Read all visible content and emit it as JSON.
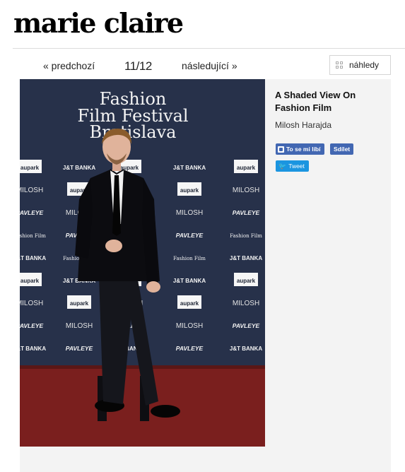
{
  "header": {
    "logo": "marie claire"
  },
  "pager": {
    "prev": "« predchozí",
    "count": "11/12",
    "next": "následující »"
  },
  "thumbs_button": {
    "label": "náhledy",
    "icon": "grid-icon"
  },
  "photo": {
    "backdrop_title": [
      "Fashion",
      "Film Festival",
      "Bratislava"
    ],
    "sponsors": {
      "bank": "J&T BANKA",
      "aupark": "aupark",
      "milosh": "MILOSH",
      "pavleye": "PAVLEYE",
      "fff": "Fashion Film Festival Bratislava"
    },
    "colors": {
      "backdrop": "#27314a",
      "carpet": "#7a1f1e",
      "suit": "#0c0c10"
    }
  },
  "caption": {
    "title": "A Shaded View On Fashion Film",
    "author": "Milosh Harajda"
  },
  "social": {
    "like": "To se mi líbí",
    "share": "Sdílet",
    "tweet": "Tweet"
  }
}
